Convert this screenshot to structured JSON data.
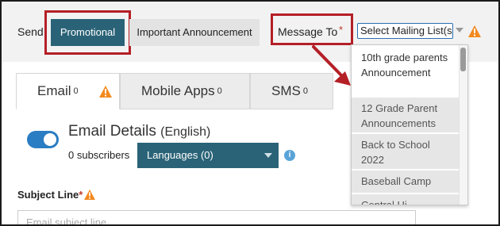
{
  "send": {
    "label": "Send",
    "promotional_label": "Promotional",
    "important_label": "Important Announcement"
  },
  "message_to": {
    "label": "Message To",
    "required_mark": "*"
  },
  "mailing_list": {
    "selected": "Select Mailing List(s)",
    "options": [
      "10th grade parents Announcement",
      "12 Grade Parent Announcements",
      "Back to School 2022",
      "Baseball Camp",
      "Central Hi..."
    ]
  },
  "tabs": [
    {
      "label": "Email",
      "count": "0"
    },
    {
      "label": "Mobile Apps",
      "count": "0"
    },
    {
      "label": "SMS",
      "count": "0"
    }
  ],
  "email": {
    "title": "Email Details",
    "language": "(English)",
    "subscribers": "0 subscribers",
    "languages_button": "Languages (0)",
    "info_symbol": "i"
  },
  "subject": {
    "label": "Subject Line",
    "required_mark": "*",
    "placeholder": "Email subject line"
  },
  "colors": {
    "teal": "#2a6377",
    "highlight_red": "#b41f26",
    "warning_orange": "#f2891e",
    "toggle_blue": "#2a7dc2"
  }
}
